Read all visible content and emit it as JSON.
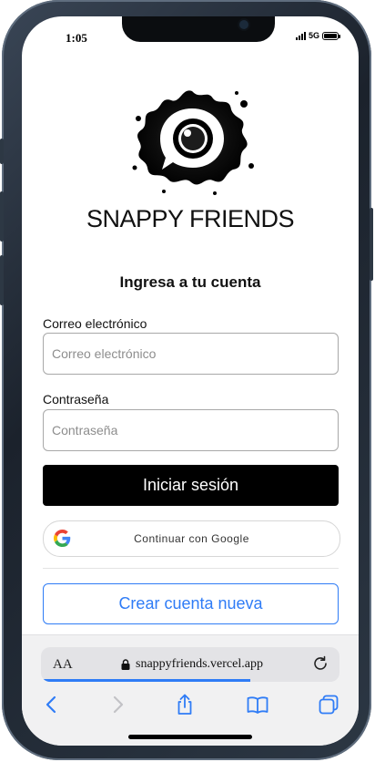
{
  "status_bar": {
    "time": "1:05",
    "network": "5G"
  },
  "app": {
    "brand_name": "SNAPPY FRIENDS",
    "heading": "Ingresa a tu cuenta"
  },
  "form": {
    "email_label": "Correo electrónico",
    "email_placeholder": "Correo electrónico",
    "email_value": "",
    "password_label": "Contraseña",
    "password_placeholder": "Contraseña",
    "password_value": "",
    "login_button": "Iniciar sesión",
    "google_button": "Continuar con Google",
    "create_account_button": "Crear cuenta nueva"
  },
  "browser": {
    "aa_label": "AA",
    "url": "snappyfriends.vercel.app",
    "load_progress_percent": 70,
    "icons": [
      "back-icon",
      "forward-icon",
      "share-icon",
      "bookmarks-icon",
      "tabs-icon",
      "lock-icon",
      "reload-icon"
    ]
  },
  "colors": {
    "primary_button": "#000000",
    "accent_blue": "#2f7cf6",
    "google_blue": "#4285F4",
    "google_red": "#EA4335",
    "google_yellow": "#FBBC05",
    "google_green": "#34A853"
  }
}
